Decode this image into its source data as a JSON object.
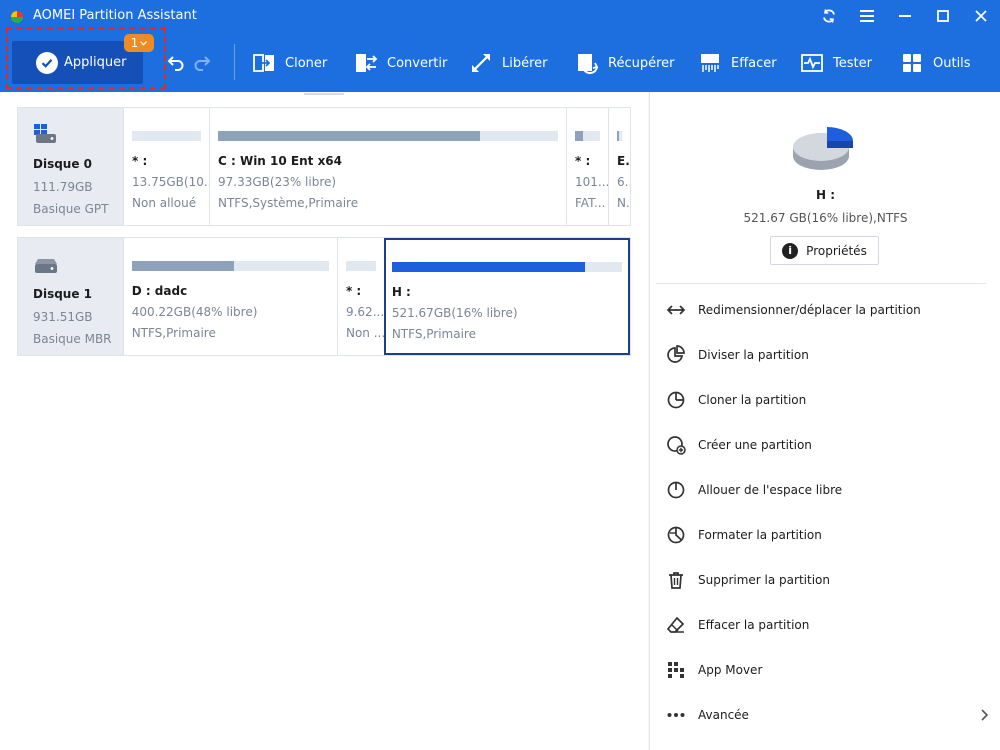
{
  "window": {
    "title": "AOMEI Partition Assistant"
  },
  "toolbar": {
    "apply_label": "Appliquer",
    "pending_count": "1",
    "items": [
      {
        "label": "Cloner",
        "icon": "clone-icon"
      },
      {
        "label": "Convertir",
        "icon": "convert-icon"
      },
      {
        "label": "Libérer",
        "icon": "free-up-icon"
      },
      {
        "label": "Récupérer",
        "icon": "recover-icon"
      },
      {
        "label": "Effacer",
        "icon": "wipe-icon"
      },
      {
        "label": "Tester",
        "icon": "test-icon"
      },
      {
        "label": "Outils",
        "icon": "tools-icon"
      }
    ]
  },
  "disks": [
    {
      "name": "Disque 0",
      "size": "111.79GB",
      "type": "Basique GPT",
      "partitions": [
        {
          "name": "* :",
          "size": "13.75GB(10...",
          "fs": "Non alloué",
          "used": 0.0
        },
        {
          "name": "C : Win 10 Ent x64",
          "size": "97.33GB(23% libre)",
          "fs": "NTFS,Système,Primaire",
          "used": 0.77
        },
        {
          "name": "* :",
          "size": "101....",
          "fs": "FAT...",
          "used": 0.3
        },
        {
          "name": "E...",
          "size": "6...",
          "fs": "N...",
          "used": 0.3
        }
      ]
    },
    {
      "name": "Disque 1",
      "size": "931.51GB",
      "type": "Basique MBR",
      "partitions": [
        {
          "name": "D : dadc",
          "size": "400.22GB(48% libre)",
          "fs": "NTFS,Primaire",
          "used": 0.52
        },
        {
          "name": "* :",
          "size": "9.62...",
          "fs": "Non ...",
          "used": 0.0
        },
        {
          "name": "H :",
          "size": "521.67GB(16% libre)",
          "fs": "NTFS,Primaire",
          "used": 0.84
        }
      ]
    }
  ],
  "selected": {
    "name": "H :",
    "info": "521.67 GB(16% libre),NTFS",
    "properties_label": "Propriétés",
    "used_fraction": 0.84
  },
  "operations": [
    {
      "label": "Redimensionner/déplacer la partition",
      "icon": "resize-icon"
    },
    {
      "label": "Diviser la partition",
      "icon": "split-icon"
    },
    {
      "label": "Cloner la partition",
      "icon": "clone-partition-icon"
    },
    {
      "label": "Créer une partition",
      "icon": "create-partition-icon"
    },
    {
      "label": "Allouer de l'espace libre",
      "icon": "allocate-icon"
    },
    {
      "label": "Formater la partition",
      "icon": "format-icon"
    },
    {
      "label": "Supprimer la partition",
      "icon": "trash-icon"
    },
    {
      "label": "Effacer la partition",
      "icon": "eraser-icon"
    },
    {
      "label": "App Mover",
      "icon": "app-mover-icon"
    },
    {
      "label": "Avancée",
      "icon": "more-icon"
    }
  ],
  "colors": {
    "accent": "#1d6fe0",
    "apply_button": "#1550b8",
    "badge": "#f08a24",
    "highlight_outline": "#e02a2a",
    "used_bar": "#8fa2bc",
    "selected_bar": "#1d5fdc"
  }
}
